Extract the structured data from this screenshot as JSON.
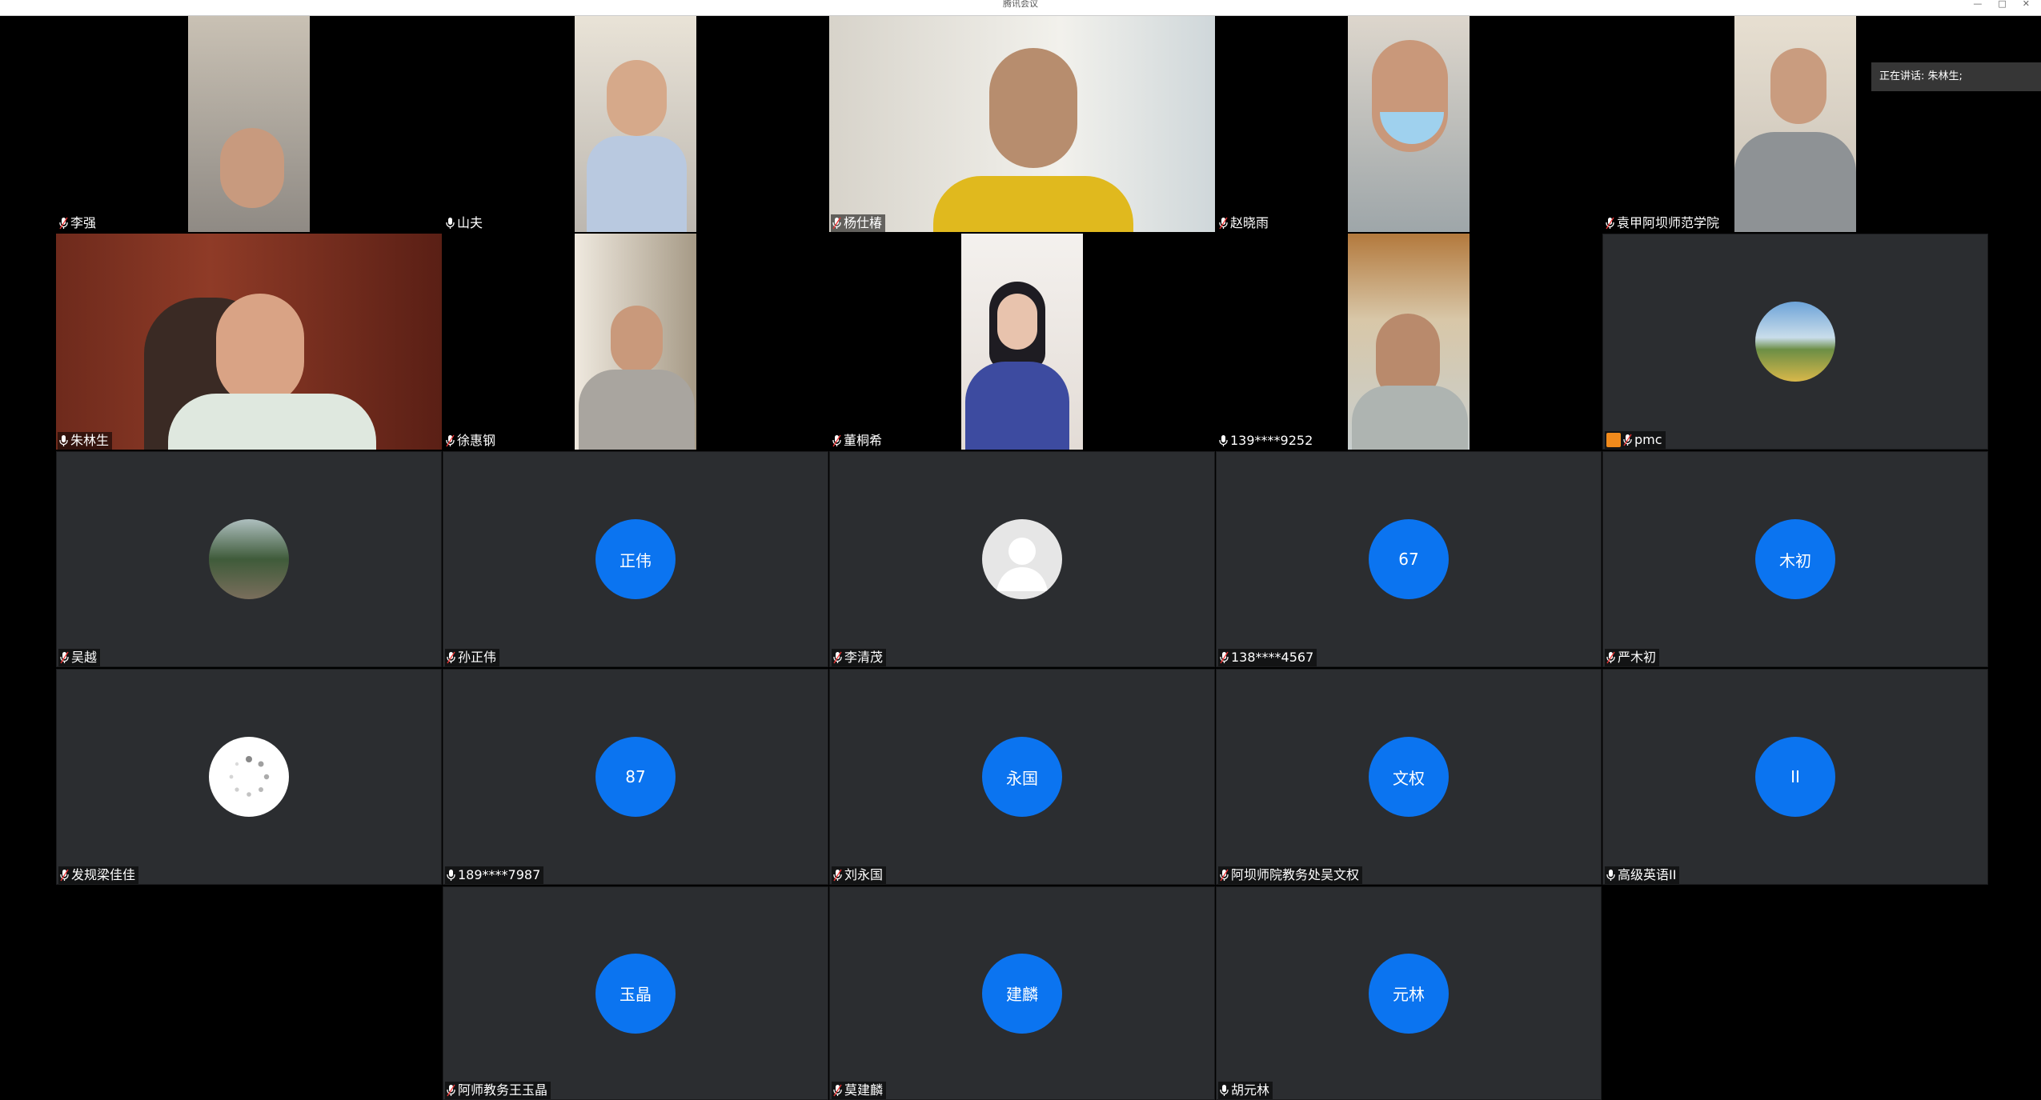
{
  "window": {
    "title": "腾讯会议"
  },
  "speaking_indicator": "正在讲话: 朱林生;",
  "participants": [
    {
      "name": "李强"
    },
    {
      "name": "山夫"
    },
    {
      "name": "杨仕椿"
    },
    {
      "name": "赵晓雨"
    },
    {
      "name": "袁甲阿坝师范学院"
    },
    {
      "name": "朱林生"
    },
    {
      "name": "徐惠钢"
    },
    {
      "name": "董桐希"
    },
    {
      "name": "139****9252"
    },
    {
      "name": "pmc"
    },
    {
      "name": "吴越"
    },
    {
      "name": "孙正伟",
      "avatar_text": "正伟"
    },
    {
      "name": "李清茂"
    },
    {
      "name": "138****4567",
      "avatar_text": "67"
    },
    {
      "name": "严木初",
      "avatar_text": "木初"
    },
    {
      "name": "发规梁佳佳"
    },
    {
      "name": "189****7987",
      "avatar_text": "87"
    },
    {
      "name": "刘永国",
      "avatar_text": "永国"
    },
    {
      "name": "阿坝师院教务处吴文权",
      "avatar_text": "文权"
    },
    {
      "name": "高级英语II",
      "avatar_text": "II"
    },
    {
      "name": "阿师教务王玉晶",
      "avatar_text": "玉晶"
    },
    {
      "name": "莫建麟",
      "avatar_text": "建麟"
    },
    {
      "name": "胡元林",
      "avatar_text": "元林"
    }
  ],
  "colors": {
    "avatar_blue": "#0b74f0",
    "tile_gray": "#2b2d30",
    "active_border": "#2fbf57"
  }
}
